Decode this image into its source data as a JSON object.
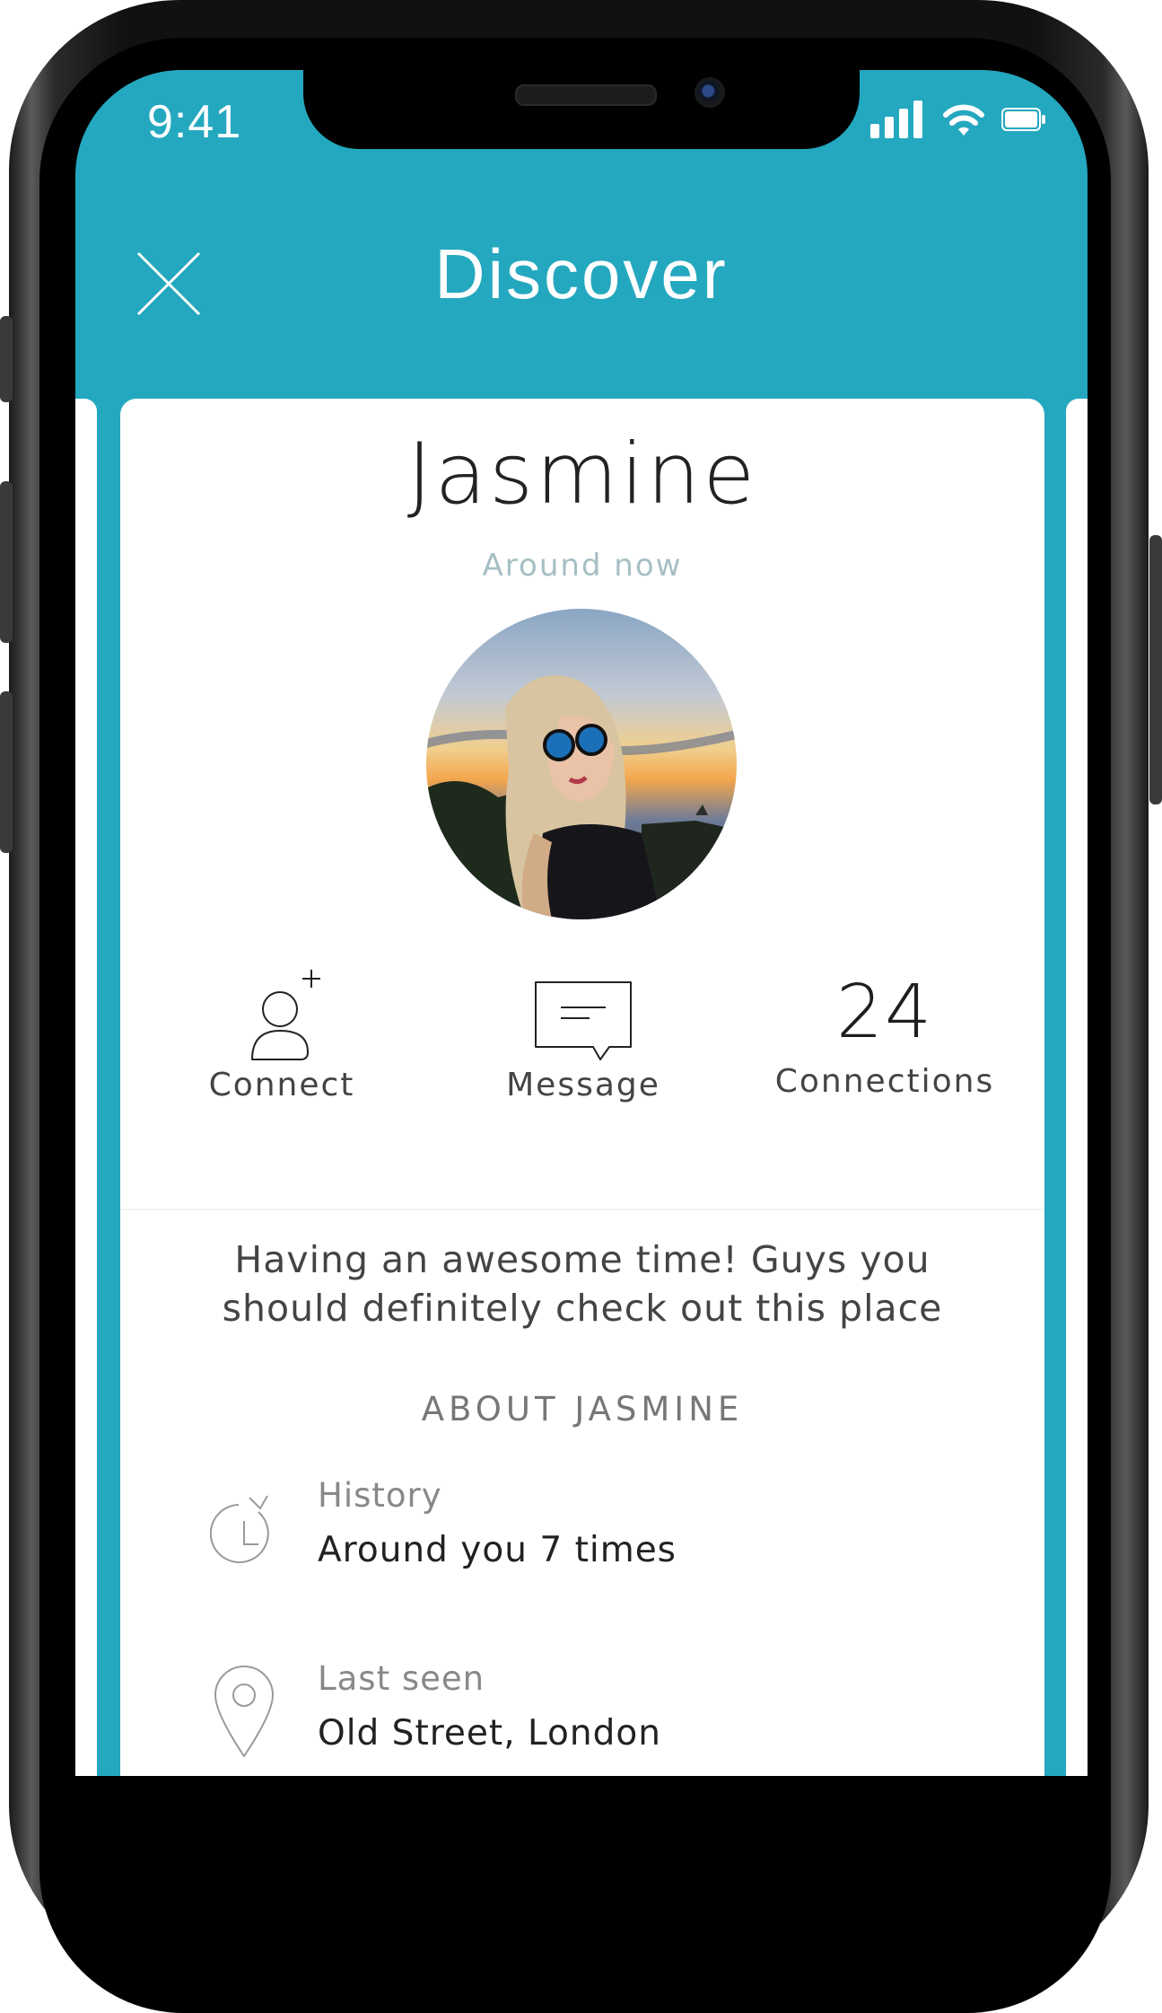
{
  "status_bar": {
    "time": "9:41",
    "signal_icon": "cellular-signal-icon",
    "wifi_icon": "wifi-icon",
    "battery_icon": "battery-icon"
  },
  "nav": {
    "title": "Discover",
    "close_icon": "close-icon"
  },
  "profile": {
    "name": "Jasmine",
    "status": "Around now",
    "avatar": "profile-photo"
  },
  "actions": {
    "connect": {
      "label": "Connect",
      "icon": "add-user-icon"
    },
    "message": {
      "label": "Message",
      "icon": "message-bubble-icon"
    },
    "connections": {
      "count": "24",
      "label": "Connections"
    }
  },
  "post": {
    "text": "Having an awesome time! Guys you should definitely check out this place"
  },
  "about": {
    "heading": "ABOUT JASMINE",
    "items": [
      {
        "label": "History",
        "value": "Around you 7 times",
        "icon": "history-icon"
      },
      {
        "label": "Last seen",
        "value": "Old Street, London",
        "icon": "location-pin-icon"
      }
    ]
  },
  "colors": {
    "accent": "#24a8bf",
    "card": "#ffffff",
    "muted_text": "#a6bfc4"
  }
}
